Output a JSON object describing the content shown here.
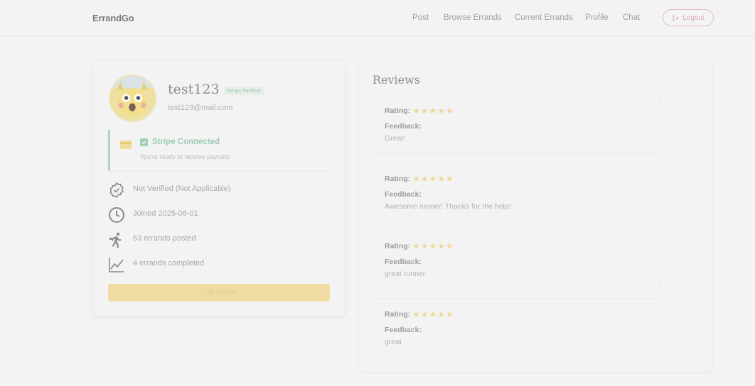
{
  "nav": {
    "brand": "ErrandGo",
    "links": [
      "Post",
      "Browse Errands",
      "Current Errands",
      "Profile",
      "Chat"
    ],
    "logout_label": "Logout"
  },
  "profile": {
    "username": "test123",
    "badge": "Stripe Verified",
    "email": "test123@mail.com",
    "stripe": {
      "title": "Stripe Connected",
      "subtitle": "You're ready to receive payouts"
    },
    "info": [
      {
        "icon": "badge-check-icon",
        "text": "Not Verified (Not Applicable)"
      },
      {
        "icon": "clock-icon",
        "text": "Joined 2025-06-01"
      },
      {
        "icon": "running-person-icon",
        "text": "53 errands posted"
      },
      {
        "icon": "chart-line-icon",
        "text": "4 errands completed"
      }
    ],
    "edit_label": "Edit Profile"
  },
  "reviews": {
    "title": "Reviews",
    "rating_label": "Rating:",
    "feedback_label": "Feedback:",
    "items": [
      {
        "stars": 5,
        "feedback": "Great!"
      },
      {
        "stars": 5,
        "feedback": "Awesome runner! Thanks for the help!"
      },
      {
        "stars": 5,
        "feedback": "great runner"
      },
      {
        "stars": 5,
        "feedback": "great"
      }
    ]
  },
  "colors": {
    "accent_yellow": "#f0dca2",
    "success_green": "#9fd0b3",
    "logout_pink": "#e3b8bf"
  }
}
